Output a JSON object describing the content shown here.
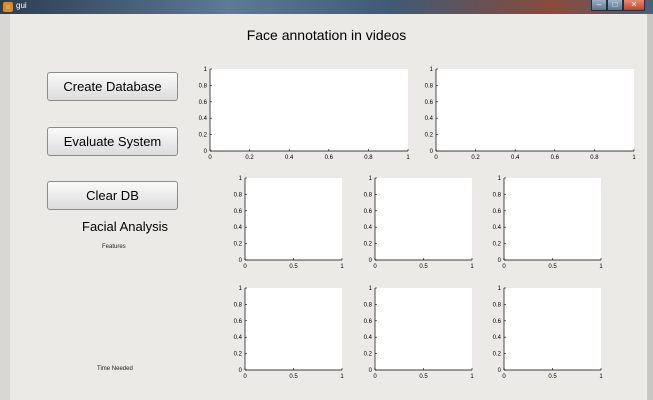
{
  "window": {
    "title": "gui",
    "controls": [
      "minimize",
      "maximize",
      "close"
    ]
  },
  "page_title": "Face annotation in videos",
  "buttons": {
    "create_database": "Create Database",
    "evaluate_system": "Evaluate System",
    "clear_db": "Clear DB"
  },
  "labels": {
    "facial_analysis": "Facial Analysis",
    "features": "Features",
    "time_needed": "Time Needed"
  },
  "chart_data": [
    {
      "type": "line",
      "xlim": [
        0,
        1
      ],
      "ylim": [
        0,
        1
      ],
      "xticks": [
        "0",
        "0.2",
        "0.4",
        "0.6",
        "0.8",
        "1"
      ],
      "yticks": [
        "0",
        "0.2",
        "0.4",
        "0.6",
        "0.8",
        "1"
      ],
      "series": []
    },
    {
      "type": "line",
      "xlim": [
        0,
        1
      ],
      "ylim": [
        0,
        1
      ],
      "xticks": [
        "0",
        "0.2",
        "0.4",
        "0.6",
        "0.8",
        "1"
      ],
      "yticks": [
        "0",
        "0.2",
        "0.4",
        "0.6",
        "0.8",
        "1"
      ],
      "series": []
    },
    {
      "type": "line",
      "xlim": [
        0,
        1
      ],
      "ylim": [
        0,
        1
      ],
      "xticks": [
        "0",
        "0.5",
        "1"
      ],
      "yticks": [
        "0",
        "0.2",
        "0.4",
        "0.6",
        "0.8",
        "1"
      ],
      "series": []
    },
    {
      "type": "line",
      "xlim": [
        0,
        1
      ],
      "ylim": [
        0,
        1
      ],
      "xticks": [
        "0",
        "0.5",
        "1"
      ],
      "yticks": [
        "0",
        "0.2",
        "0.4",
        "0.6",
        "0.8",
        "1"
      ],
      "series": []
    },
    {
      "type": "line",
      "xlim": [
        0,
        1
      ],
      "ylim": [
        0,
        1
      ],
      "xticks": [
        "0",
        "0.5",
        "1"
      ],
      "yticks": [
        "0",
        "0.2",
        "0.4",
        "0.6",
        "0.8",
        "1"
      ],
      "series": []
    },
    {
      "type": "line",
      "xlim": [
        0,
        1
      ],
      "ylim": [
        0,
        1
      ],
      "xticks": [
        "0",
        "0.5",
        "1"
      ],
      "yticks": [
        "0",
        "0.2",
        "0.4",
        "0.6",
        "0.8",
        "1"
      ],
      "series": []
    },
    {
      "type": "line",
      "xlim": [
        0,
        1
      ],
      "ylim": [
        0,
        1
      ],
      "xticks": [
        "0",
        "0.5",
        "1"
      ],
      "yticks": [
        "0",
        "0.2",
        "0.4",
        "0.6",
        "0.8",
        "1"
      ],
      "series": []
    },
    {
      "type": "line",
      "xlim": [
        0,
        1
      ],
      "ylim": [
        0,
        1
      ],
      "xticks": [
        "0",
        "0.5",
        "1"
      ],
      "yticks": [
        "0",
        "0.2",
        "0.4",
        "0.6",
        "0.8",
        "1"
      ],
      "series": []
    }
  ]
}
